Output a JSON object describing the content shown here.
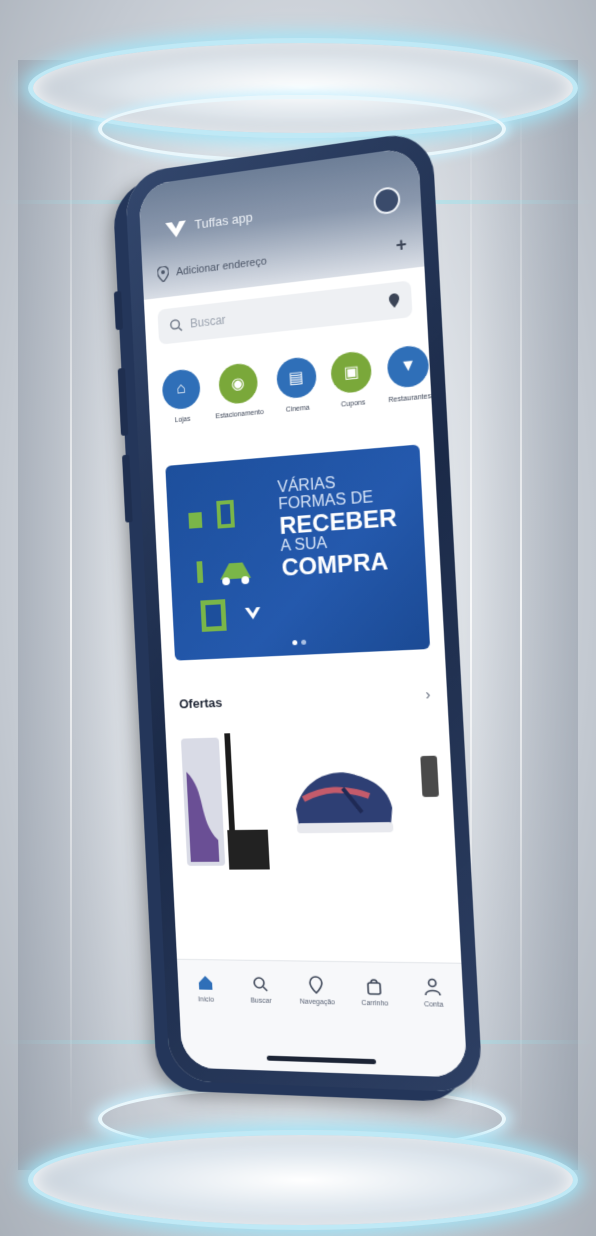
{
  "app": {
    "title": "Tuffas app",
    "address_placeholder": "Adicionar endereço",
    "search_placeholder": "Buscar",
    "avatar_icon": "user-icon",
    "logo_icon": "brand-v-logo"
  },
  "categories": [
    {
      "label": "Lojas",
      "color": "#2f6fb8",
      "icon": "store-icon"
    },
    {
      "label": "Estacionamento",
      "color": "#7aa83a",
      "icon": "car-icon"
    },
    {
      "label": "Cinema",
      "color": "#2f6fb8",
      "icon": "ticket-icon"
    },
    {
      "label": "Cupons",
      "color": "#7aa83a",
      "icon": "coupon-icon"
    },
    {
      "label": "Restaurantes",
      "color": "#2f6fb8",
      "icon": "food-icon"
    }
  ],
  "banner": {
    "line1": "Várias",
    "line2": "formas de",
    "line3": "Receber",
    "line4": "a sua",
    "line5": "Compra",
    "slides": 2,
    "active_slide": 0,
    "colors": {
      "bg": "#1d4f9c",
      "accent": "#7ab648"
    }
  },
  "offers": {
    "title": "Ofertas",
    "arrow": "›"
  },
  "tabs": [
    {
      "label": "Início",
      "icon": "home-icon",
      "active": true
    },
    {
      "label": "Buscar",
      "icon": "search-icon",
      "active": false
    },
    {
      "label": "Navegação",
      "icon": "location-icon",
      "active": false
    },
    {
      "label": "Carrinho",
      "icon": "bag-icon",
      "active": false
    },
    {
      "label": "Conta",
      "icon": "user-icon",
      "active": false
    }
  ]
}
